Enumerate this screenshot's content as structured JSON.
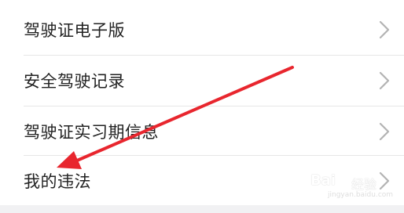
{
  "menu": {
    "items": [
      {
        "label": "驾驶证电子版"
      },
      {
        "label": "安全驾驶记录"
      },
      {
        "label": "驾驶证实习期信息"
      },
      {
        "label": "我的违法"
      }
    ]
  },
  "annotation": {
    "arrow_color": "#e8262e"
  },
  "watermark": {
    "brand": "Bai",
    "cn": "经验",
    "url": "jingyan.baidu.com"
  },
  "colors": {
    "background": "#ffffff",
    "page_background": "#f1f1f3",
    "text": "#222222",
    "divider": "#e6e6e6",
    "chevron": "#b3b3b3"
  }
}
